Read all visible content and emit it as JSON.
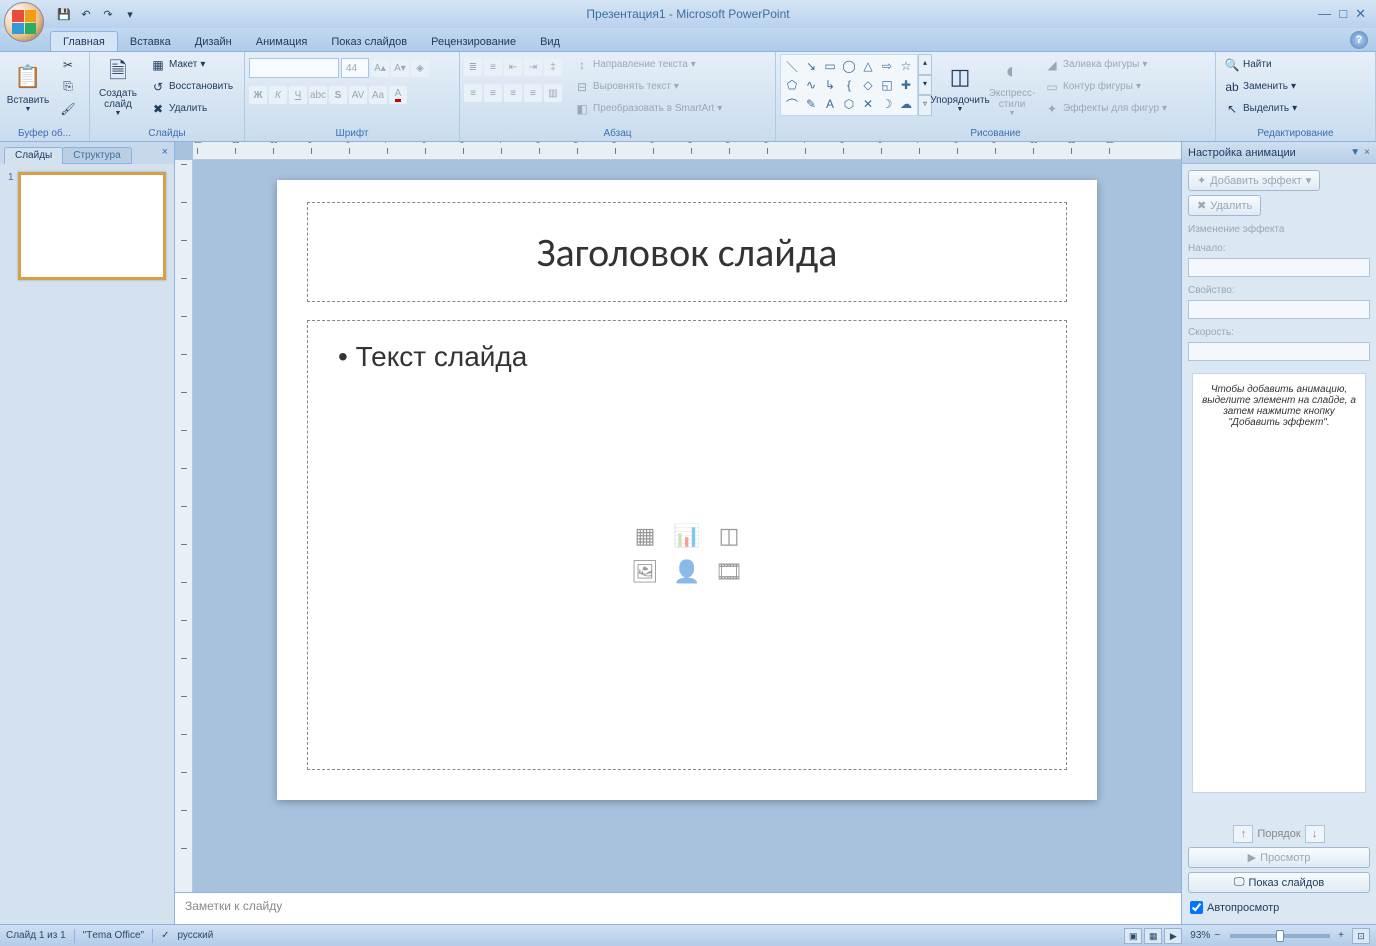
{
  "title": "Презентация1 - Microsoft PowerPoint",
  "tabs": [
    "Главная",
    "Вставка",
    "Дизайн",
    "Анимация",
    "Показ слайдов",
    "Рецензирование",
    "Вид"
  ],
  "activeTab": 0,
  "ribbon": {
    "clipboard": {
      "label": "Буфер об...",
      "paste": "Вставить"
    },
    "slides": {
      "label": "Слайды",
      "new": "Создать слайд",
      "layout": "Макет",
      "reset": "Восстановить",
      "delete": "Удалить"
    },
    "font": {
      "label": "Шрифт",
      "fontSize": "44"
    },
    "paragraph": {
      "label": "Абзац",
      "direction": "Направление текста",
      "align": "Выровнять текст",
      "smartart": "Преобразовать в SmartArt"
    },
    "drawing": {
      "label": "Рисование",
      "arrange": "Упорядочить",
      "styles": "Экспресс-стили",
      "fill": "Заливка фигуры",
      "outline": "Контур фигуры",
      "effects": "Эффекты для фигур"
    },
    "editing": {
      "label": "Редактирование",
      "find": "Найти",
      "replace": "Заменить",
      "select": "Выделить"
    }
  },
  "sidepanel": {
    "tabs": [
      "Слайды",
      "Структура"
    ],
    "activeTab": 0,
    "slideNum": "1"
  },
  "slide": {
    "title": "Заголовок слайда",
    "body": "Текст слайда"
  },
  "notes": {
    "placeholder": "Заметки к слайду"
  },
  "taskpane": {
    "title": "Настройка анимации",
    "addEffect": "Добавить эффект",
    "remove": "Удалить",
    "modifyLabel": "Изменение эффекта",
    "startLabel": "Начало:",
    "propLabel": "Свойство:",
    "speedLabel": "Скорость:",
    "hint": "Чтобы добавить анимацию, выделите элемент на слайде, а затем нажмите кнопку \"Добавить эффект\".",
    "reorder": "Порядок",
    "preview": "Просмотр",
    "slideshow": "Показ слайдов",
    "autopreview": "Автопросмотр"
  },
  "status": {
    "pos": "Слайд 1 из 1",
    "theme": "\"Тema Office\"",
    "lang": "русский",
    "zoom": "93%"
  },
  "rulerH": [
    "12",
    "11",
    "10",
    "9",
    "8",
    "7",
    "6",
    "5",
    "4",
    "3",
    "2",
    "1",
    "0",
    "1",
    "2",
    "3",
    "4",
    "5",
    "6",
    "7",
    "8",
    "9",
    "10",
    "11",
    "12"
  ],
  "rulerV": [
    "9",
    "8",
    "7",
    "6",
    "5",
    "4",
    "3",
    "2",
    "1",
    "0",
    "1",
    "2",
    "3",
    "4",
    "5",
    "6",
    "7",
    "8",
    "9"
  ]
}
